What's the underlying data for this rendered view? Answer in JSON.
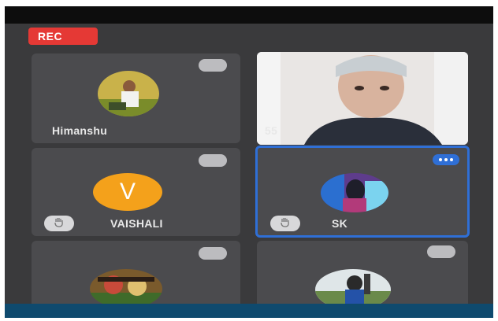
{
  "recording": {
    "badge_label": "REC"
  },
  "participants": [
    {
      "name": "Himanshu",
      "avatar": "photo-avatar"
    },
    {
      "name": "55",
      "avatar": "camera-video"
    },
    {
      "name": "VAISHALI",
      "initial": "V",
      "avatar_color": "#f4a11b",
      "hand_raised_icon": "hand-icon"
    },
    {
      "name": "SK",
      "avatar": "photo-avatar",
      "active": true,
      "hand_raised_icon": "hand-icon"
    },
    {
      "name": "",
      "avatar": "photo-avatar"
    },
    {
      "name": "",
      "avatar": "photo-avatar"
    }
  ],
  "colors": {
    "accent": "#2f6fd6",
    "rec": "#e53935",
    "tile_bg": "#4b4b4e",
    "screen_bg": "#3a3a3c"
  }
}
